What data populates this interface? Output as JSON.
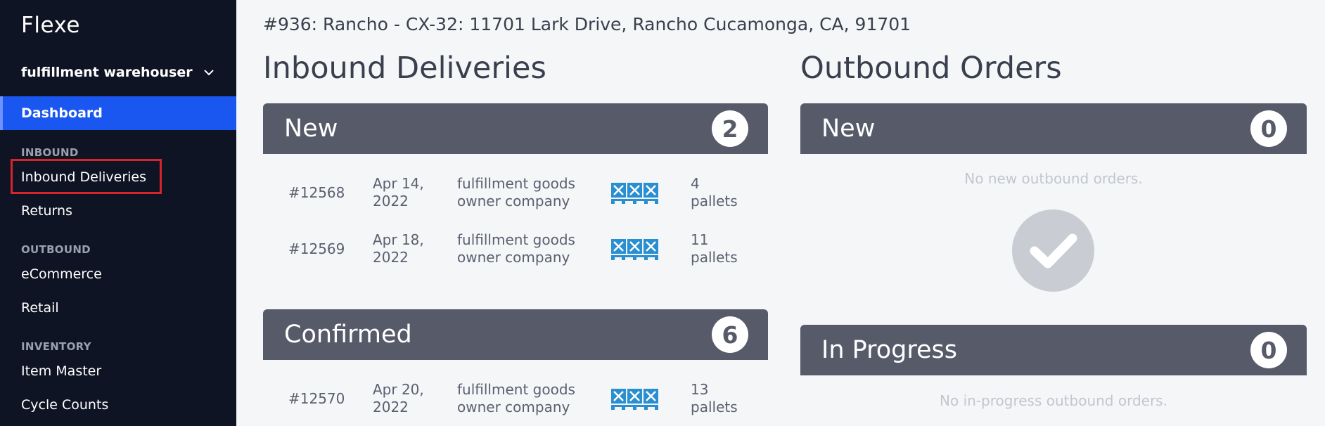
{
  "app": {
    "logo": "Flexe"
  },
  "sidebar": {
    "org_name": "fulfillment warehouser",
    "active": "Dashboard",
    "sections": [
      {
        "title": "INBOUND",
        "items": [
          "Inbound Deliveries",
          "Returns"
        ]
      },
      {
        "title": "OUTBOUND",
        "items": [
          "eCommerce",
          "Retail"
        ]
      },
      {
        "title": "INVENTORY",
        "items": [
          "Item Master",
          "Cycle Counts"
        ]
      }
    ]
  },
  "location": "#936: Rancho - CX-32: 11701 Lark Drive, Rancho Cucamonga, CA, 91701",
  "inbound": {
    "title": "Inbound Deliveries",
    "new": {
      "label": "New",
      "count": "2",
      "rows": [
        {
          "id": "#12568",
          "date": [
            "Apr 14,",
            "2022"
          ],
          "owner": [
            "fulfillment goods",
            "owner company"
          ],
          "pallets": [
            "4",
            "pallets"
          ]
        },
        {
          "id": "#12569",
          "date": [
            "Apr 18,",
            "2022"
          ],
          "owner": [
            "fulfillment goods",
            "owner company"
          ],
          "pallets": [
            "11",
            "pallets"
          ]
        }
      ]
    },
    "confirmed": {
      "label": "Confirmed",
      "count": "6",
      "rows": [
        {
          "id": "#12570",
          "date": [
            "Apr 20,",
            "2022"
          ],
          "owner": [
            "fulfillment goods",
            "owner company"
          ],
          "pallets": [
            "13",
            "pallets"
          ]
        }
      ]
    }
  },
  "outbound": {
    "title": "Outbound Orders",
    "new": {
      "label": "New",
      "count": "0",
      "empty": "No new outbound orders."
    },
    "in_progress": {
      "label": "In Progress",
      "count": "0",
      "empty": "No in-progress outbound orders."
    }
  },
  "colors": {
    "sidebar_bg": "#0f1424",
    "active_nav": "#1a56f0",
    "panel_header": "#575a69",
    "pallet_icon": "#2a8fd0",
    "highlight_border": "#d9232a"
  }
}
